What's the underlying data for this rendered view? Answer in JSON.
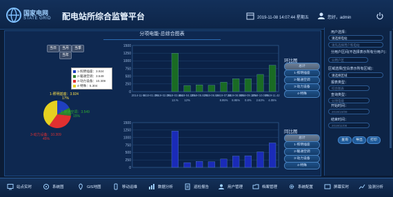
{
  "header": {
    "logo_cn": "国家电网",
    "logo_en": "STATE GRID",
    "title": "配电站所综合监管平台",
    "datetime": "2019-11-08 14:07:44 星期五",
    "user": "您好，admin"
  },
  "panel": {
    "title": "分项电能-总综合图表",
    "tabs": [
      "当日",
      "当月",
      "当季",
      "当年"
    ],
    "pie": {
      "legend": [
        "1-照明插座：3.924",
        "2-暖通空调：3.549",
        "3-动力设备：10.309",
        "4-特殊：5.304"
      ],
      "labels": [
        {
          "name": "1-照明插座：3.924",
          "pct": "17%"
        },
        {
          "name": "2-暖通空调：3.549",
          "pct": "15%"
        },
        {
          "name": "3-动力设备：10.309",
          "pct": "45%"
        }
      ],
      "colors": [
        "#1f3fbf",
        "#2f7f2f",
        "#e03030",
        "#e6d020"
      ]
    }
  },
  "chart_data": [
    {
      "type": "bar",
      "title": "环比图",
      "x": [
        "2014-11-%",
        "2019-01.0%",
        "2019-02.0%",
        "2019-03.654",
        "2019-04.12%",
        "2019-05.82%",
        "2019-06.5%",
        "2019-07.18",
        "2019-08.95%",
        "2019-09.12%",
        "2019-10.08%",
        "2019-11.42"
      ],
      "x_secondary": [
        "",
        "",
        "",
        "13.%",
        "12%",
        "",
        "",
        "8.95%",
        "8.95%",
        "0.8%",
        "2.63%",
        "4.05%"
      ],
      "values": [
        0,
        0,
        0,
        1250,
        200,
        220,
        210,
        310,
        420,
        420,
        560,
        860
      ],
      "ylim": [
        0,
        1500
      ],
      "yticks": [
        0,
        250,
        500,
        750,
        1000,
        1250,
        1500
      ],
      "color": "#1a6b24"
    },
    {
      "type": "bar",
      "title": "同比图",
      "x": [
        "",
        "",
        "",
        "",
        "",
        "",
        "",
        "",
        "",
        "",
        "",
        ""
      ],
      "values": [
        0,
        0,
        0,
        1220,
        160,
        200,
        190,
        280,
        380,
        390,
        520,
        820
      ],
      "ylim": [
        0,
        1500
      ],
      "yticks": [
        0,
        250,
        500,
        750,
        1000,
        1250,
        1500
      ],
      "color": "#1a2bb8"
    }
  ],
  "side_buttons": {
    "top_title": "环比图",
    "bottom_title": "同比图",
    "items": [
      "总计",
      "1-照明插座",
      "2-暖通空调",
      "3-动力设备",
      "4-特殊"
    ]
  },
  "filters": {
    "user_label": "用户选择：",
    "user_value": "请选择电站",
    "station_value": "请先选择用户和电站",
    "station_note": "分用户区间(不选择表示所有分用户)：",
    "sub_user_value": "分用户区",
    "region_label": "区域选择(空白表示所有区域)：",
    "region_value": "请选择区域",
    "type_label": "报表类型：",
    "type_value": "综合图表",
    "scope_label": "查询类型：",
    "scope_value": "分项电能",
    "start_label": "开始时间：",
    "start_value": "2019/10/09",
    "end_label": "结束时间：",
    "end_value": "2019/11/08",
    "actions": [
      "查询",
      "导出",
      "打印"
    ]
  },
  "nav": {
    "items": [
      "站点实时",
      "系统图",
      "GIS地图",
      "移动运维",
      "数据分析",
      "巡检报告",
      "用户管理",
      "档案管理",
      "系统配置",
      "屏幕实时",
      "监测分析"
    ]
  }
}
